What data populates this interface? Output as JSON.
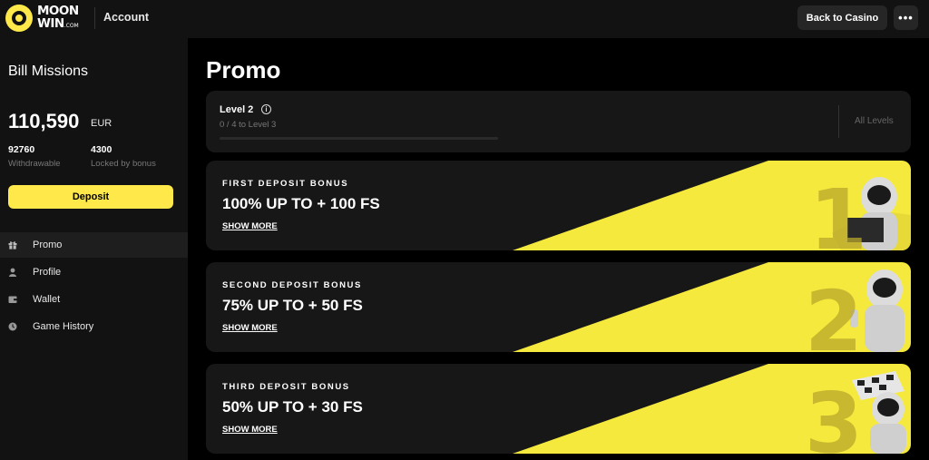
{
  "header": {
    "logo_line1": "MOON",
    "logo_line2": "WIN",
    "logo_suffix": ".COM",
    "section": "Account",
    "back_label": "Back to Casino",
    "more_label": "•••"
  },
  "sidebar": {
    "user_name": "Bill Missions",
    "balance": "110,590",
    "currency": "EUR",
    "withdrawable_value": "92760",
    "withdrawable_label": "Withdrawable",
    "locked_value": "4300",
    "locked_label": "Locked by bonus",
    "deposit_label": "Deposit",
    "nav": [
      {
        "label": "Promo",
        "icon": "gift-icon",
        "active": true
      },
      {
        "label": "Profile",
        "icon": "user-icon",
        "active": false
      },
      {
        "label": "Wallet",
        "icon": "wallet-icon",
        "active": false
      },
      {
        "label": "Game History",
        "icon": "clock-icon",
        "active": false
      }
    ]
  },
  "main": {
    "title": "Promo",
    "level": {
      "title": "Level 2",
      "info_glyph": "i",
      "progress_text": "0 / 4 to Level 3",
      "progress_fraction": 0,
      "all_levels_label": "All Levels"
    },
    "bonuses": [
      {
        "label": "FIRST DEPOSIT BONUS",
        "title": "100% UP TO + 100 FS",
        "more": "SHOW MORE",
        "number": "1"
      },
      {
        "label": "SECOND DEPOSIT BONUS",
        "title": "75% UP TO + 50 FS",
        "more": "SHOW MORE",
        "number": "2"
      },
      {
        "label": "THIRD DEPOSIT BONUS",
        "title": "50% UP TO + 30 FS",
        "more": "SHOW MORE",
        "number": "3"
      }
    ]
  },
  "colors": {
    "accent": "#ffe94a",
    "background": "#000000",
    "panel": "#121212",
    "card": "#171717"
  }
}
